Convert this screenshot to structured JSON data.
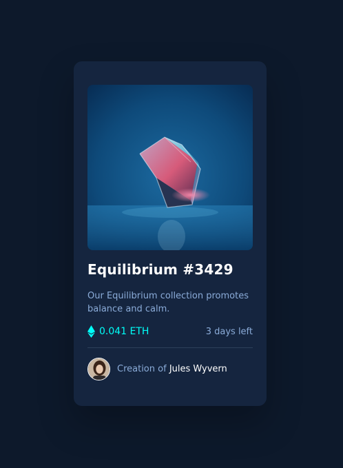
{
  "card": {
    "title": "Equilibrium #3429",
    "description": "Our Equilibrium collection promotes balance and calm.",
    "price": "0.041 ETH",
    "time_left": "3 days left",
    "creator_prefix": "Creation of",
    "creator_name": "Jules Wyvern"
  },
  "icons": {
    "price": "ethereum-icon",
    "avatar": "creator-avatar"
  },
  "colors": {
    "page_bg": "#0d192b",
    "card_bg": "#15253f",
    "accent": "#00fff8",
    "soft_blue": "#8bacd9",
    "divider": "#2e405a",
    "white": "#ffffff"
  }
}
